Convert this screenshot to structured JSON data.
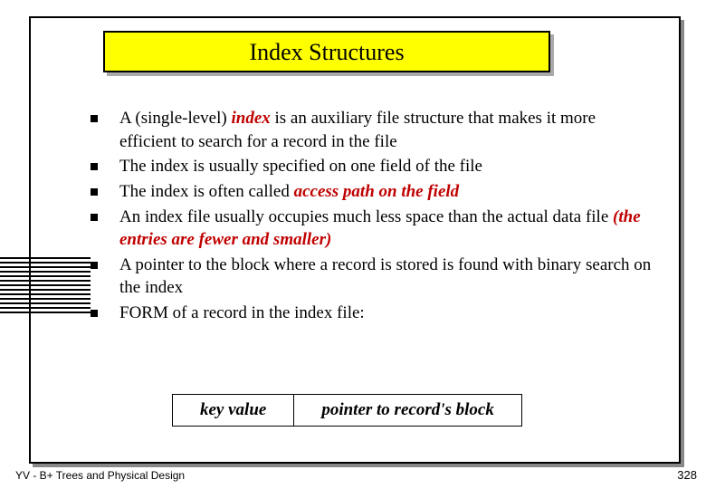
{
  "title": "Index  Structures",
  "bullets": [
    {
      "prefix": "A  (single-level)  ",
      "em1": "index",
      "mid": "  is an auxiliary file structure that makes it more efficient to search for a record in the file",
      "em2": "",
      "suffix": ""
    },
    {
      "prefix": "The index is usually specified on one field of the file",
      "em1": "",
      "mid": "",
      "em2": "",
      "suffix": ""
    },
    {
      "prefix": "The index is often called  ",
      "em1": "access path on the field",
      "mid": "",
      "em2": "",
      "suffix": ""
    },
    {
      "prefix": "An index file usually occupies much less space than the actual data file ",
      "em1": "",
      "mid": "",
      "em2": "(the entries are fewer and smaller)",
      "suffix": ""
    },
    {
      "prefix": "A pointer to the block where a record is stored is found with binary search on the index",
      "em1": "",
      "mid": "",
      "em2": "",
      "suffix": ""
    },
    {
      "prefix": " FORM of a record in the index file:",
      "em1": "",
      "mid": "",
      "em2": "",
      "suffix": ""
    }
  ],
  "record": {
    "left": "key value",
    "right": "pointer to record's block"
  },
  "footer": {
    "left": "YV   -   B+ Trees and Physical Design",
    "right": "328"
  }
}
